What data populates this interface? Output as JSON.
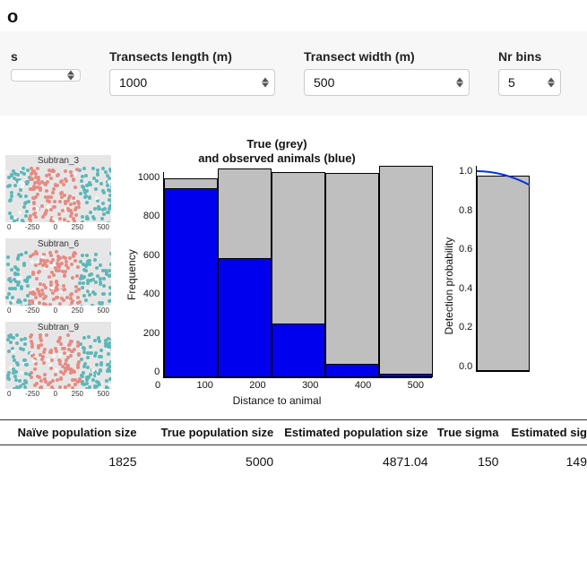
{
  "header_fragment": "o",
  "controls": {
    "col0_label_fragment": "s",
    "col0_value": "",
    "transects_length": {
      "label": "Transects length (m)",
      "value": "1000"
    },
    "transect_width": {
      "label": "Transect width (m)",
      "value": "500"
    },
    "nr_bins": {
      "label": "Nr bins",
      "value": "5"
    }
  },
  "subtransects": {
    "titles": [
      "Subtran_3",
      "Subtran_6",
      "Subtran_9"
    ],
    "x_ticks": [
      "0",
      "-250",
      "0",
      "250",
      "500"
    ]
  },
  "chart_data": [
    {
      "type": "bar",
      "title": "True (grey)\nand observed animals (blue)",
      "xlabel": "Distance to animal",
      "ylabel": "Frequency",
      "x_ticks": [
        0,
        100,
        200,
        300,
        400,
        500
      ],
      "ylim": [
        0,
        1000
      ],
      "y_ticks": [
        0,
        200,
        400,
        600,
        800,
        1000
      ],
      "categories": [
        "0-100",
        "100-200",
        "200-300",
        "300-400",
        "400-500"
      ],
      "series": [
        {
          "name": "True (grey)",
          "values": [
            965,
            1010,
            995,
            990,
            1025
          ]
        },
        {
          "name": "Observed (blue)",
          "values": [
            915,
            575,
            260,
            65,
            15
          ]
        }
      ]
    },
    {
      "type": "bar+line",
      "title": "",
      "ylabel": "Detection probability",
      "ylim": [
        0,
        1.0
      ],
      "y_ticks": [
        0.0,
        0.2,
        0.4,
        0.6,
        0.8,
        1.0
      ],
      "first_bar_visible_height": 0.95,
      "note": "Fitted half-normal detection curve overlaid; only leftmost bin and curve segment visible in crop."
    }
  ],
  "results": {
    "headers": [
      "Naïve population size",
      "True population size",
      "Estimated population size",
      "True sigma",
      "Estimated sig"
    ],
    "values": [
      "1825",
      "5000",
      "4871.04",
      "150",
      "149"
    ]
  }
}
